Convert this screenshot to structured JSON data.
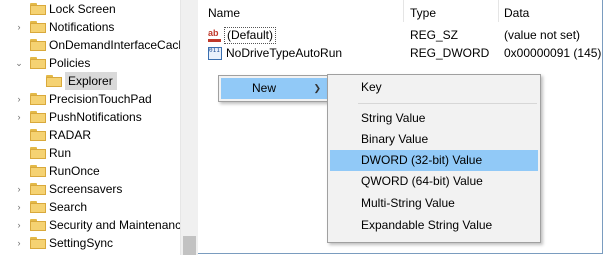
{
  "tree": {
    "items": [
      {
        "label": "Lock Screen",
        "expander": ""
      },
      {
        "label": "Notifications",
        "expander": "›"
      },
      {
        "label": "OnDemandInterfaceCach",
        "expander": ""
      },
      {
        "label": "Policies",
        "expander": "⌄"
      },
      {
        "label": "Explorer",
        "expander": ""
      },
      {
        "label": "PrecisionTouchPad",
        "expander": "›"
      },
      {
        "label": "PushNotifications",
        "expander": "›"
      },
      {
        "label": "RADAR",
        "expander": ""
      },
      {
        "label": "Run",
        "expander": ""
      },
      {
        "label": "RunOnce",
        "expander": ""
      },
      {
        "label": "Screensavers",
        "expander": "›"
      },
      {
        "label": "Search",
        "expander": "›"
      },
      {
        "label": "Security and Maintenanc",
        "expander": "›"
      },
      {
        "label": "SettingSync",
        "expander": "›"
      }
    ]
  },
  "values_pane": {
    "columns": {
      "name": "Name",
      "type": "Type",
      "data": "Data"
    },
    "rows": [
      {
        "icon": "string-value-icon",
        "icon_text": "ab",
        "name": "(Default)",
        "type": "REG_SZ",
        "data": "(value not set)"
      },
      {
        "icon": "binary-value-icon",
        "icon_text": "011 110",
        "name": "NoDriveTypeAutoRun",
        "type": "REG_DWORD",
        "data": "0x00000091 (145)"
      }
    ]
  },
  "context_menu": {
    "new_label": "New",
    "submenu_arrow": "❯"
  },
  "submenu": {
    "items": [
      "Key",
      "String Value",
      "Binary Value",
      "DWORD (32-bit) Value",
      "QWORD (64-bit) Value",
      "Multi-String Value",
      "Expandable String Value"
    ],
    "highlighted": "DWORD (32-bit) Value"
  },
  "colors": {
    "highlight": "#91c9f7",
    "folder": "#f5d272",
    "selection": "#d9d9d9"
  }
}
